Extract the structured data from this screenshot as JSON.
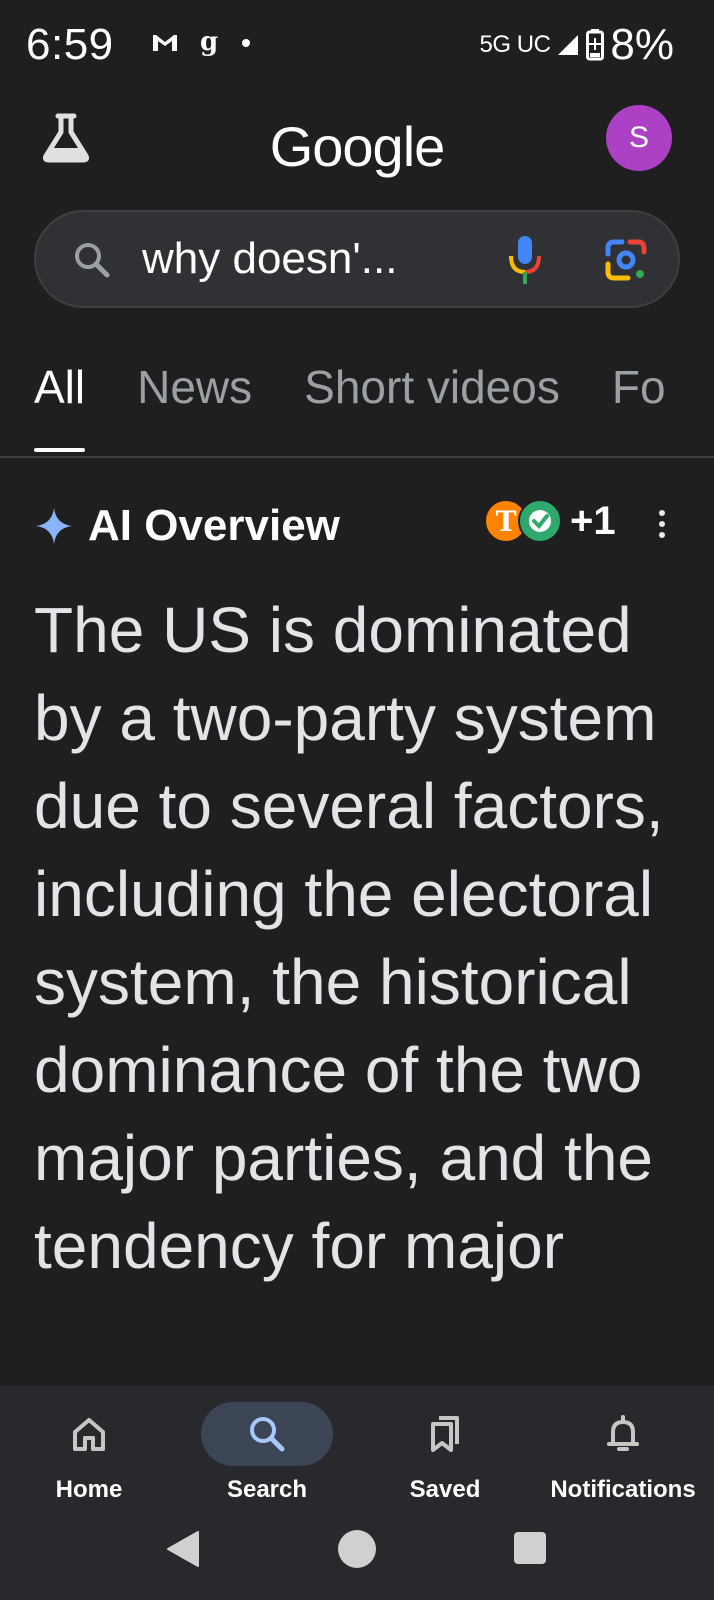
{
  "status_bar": {
    "time": "6:59",
    "network": "5G UC",
    "battery": "8%",
    "icons": [
      "gmail-icon",
      "g-app-icon",
      "notification-dot-icon",
      "signal-icon",
      "battery-icon"
    ]
  },
  "header": {
    "logo": "Google",
    "avatar_letter": "S",
    "avatar_color": "#ad41c6"
  },
  "search": {
    "query": "why doesn'..."
  },
  "tabs": [
    {
      "label": "All",
      "active": true
    },
    {
      "label": "News",
      "active": false
    },
    {
      "label": "Short videos",
      "active": false
    },
    {
      "label": "Fo",
      "active": false
    }
  ],
  "ai_overview": {
    "title": "AI Overview",
    "source_letter": "T",
    "source_count": "+1",
    "body": "The US is dominated by a two-party system due to several factors, including the electoral system, the historical dominance of the two major parties, and the tendency for major"
  },
  "bottom_nav": {
    "items": [
      {
        "label": "Home",
        "icon": "home-icon",
        "active": false
      },
      {
        "label": "Search",
        "icon": "search-icon",
        "active": true
      },
      {
        "label": "Saved",
        "icon": "bookmarks-icon",
        "active": false
      },
      {
        "label": "Notifications",
        "icon": "bell-icon",
        "active": false
      }
    ]
  },
  "colors": {
    "background": "#1f1f1f",
    "active_pill": "#3c4555",
    "tennessee_orange": "#ff8200"
  }
}
